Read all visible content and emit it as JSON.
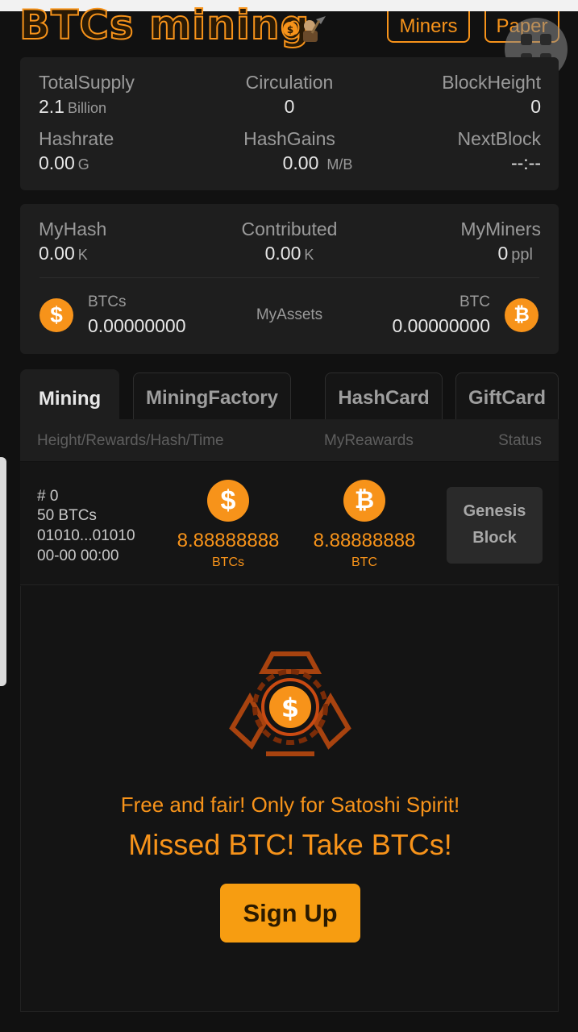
{
  "header": {
    "logo_text": "BTCs mining",
    "miners_label": "Miners",
    "paper_label": "Paper"
  },
  "stats": {
    "total_supply_label": "TotalSupply",
    "total_supply_value": "2.1",
    "total_supply_unit": "Billion",
    "circulation_label": "Circulation",
    "circulation_value": "0",
    "block_height_label": "BlockHeight",
    "block_height_value": "0",
    "hashrate_label": "Hashrate",
    "hashrate_value": "0.00",
    "hashrate_unit": "G",
    "hash_gains_label": "HashGains",
    "hash_gains_value": "0.00",
    "hash_gains_unit": "M/B",
    "next_block_label": "NextBlock",
    "next_block_value": "--:--"
  },
  "my": {
    "my_hash_label": "MyHash",
    "my_hash_value": "0.00",
    "my_hash_unit": "K",
    "contributed_label": "Contributed",
    "contributed_value": "0.00",
    "contributed_unit": "K",
    "my_miners_label": "MyMiners",
    "my_miners_value": "0",
    "my_miners_unit": "ppl",
    "btcs_label": "BTCs",
    "btcs_value": "0.00000000",
    "my_assets_label": "MyAssets",
    "btc_label": "BTC",
    "btc_value": "0.00000000"
  },
  "tabs": [
    {
      "label": "Mining",
      "active": true
    },
    {
      "label": "MiningFactory",
      "active": false
    },
    {
      "label": "HashCard",
      "active": false
    },
    {
      "label": "GiftCard",
      "active": false
    }
  ],
  "table": {
    "col1": "Height/Rewards/Hash/Time",
    "col2": "MyReawards",
    "col3": "Status",
    "rows": [
      {
        "height": "# 0",
        "rewards": "50 BTCs",
        "hash": "01010...01010",
        "time": "00-00 00:00",
        "btcs_amount": "8.88888888",
        "btcs_unit": "BTCs",
        "btc_amount": "8.88888888",
        "btc_unit": "BTC",
        "status_line1": "Genesis",
        "status_line2": "Block"
      }
    ]
  },
  "promo": {
    "tagline1": "Free and fair! Only for Satoshi Spirit!",
    "tagline2": "Missed BTC!  Take BTCs!",
    "signup_label": "Sign Up"
  },
  "icons": {
    "dollar_glyph": "$",
    "bitcoin_glyph": "₿"
  },
  "colors": {
    "accent": "#f7931a",
    "background": "#111111",
    "card": "#1e1e1e"
  }
}
